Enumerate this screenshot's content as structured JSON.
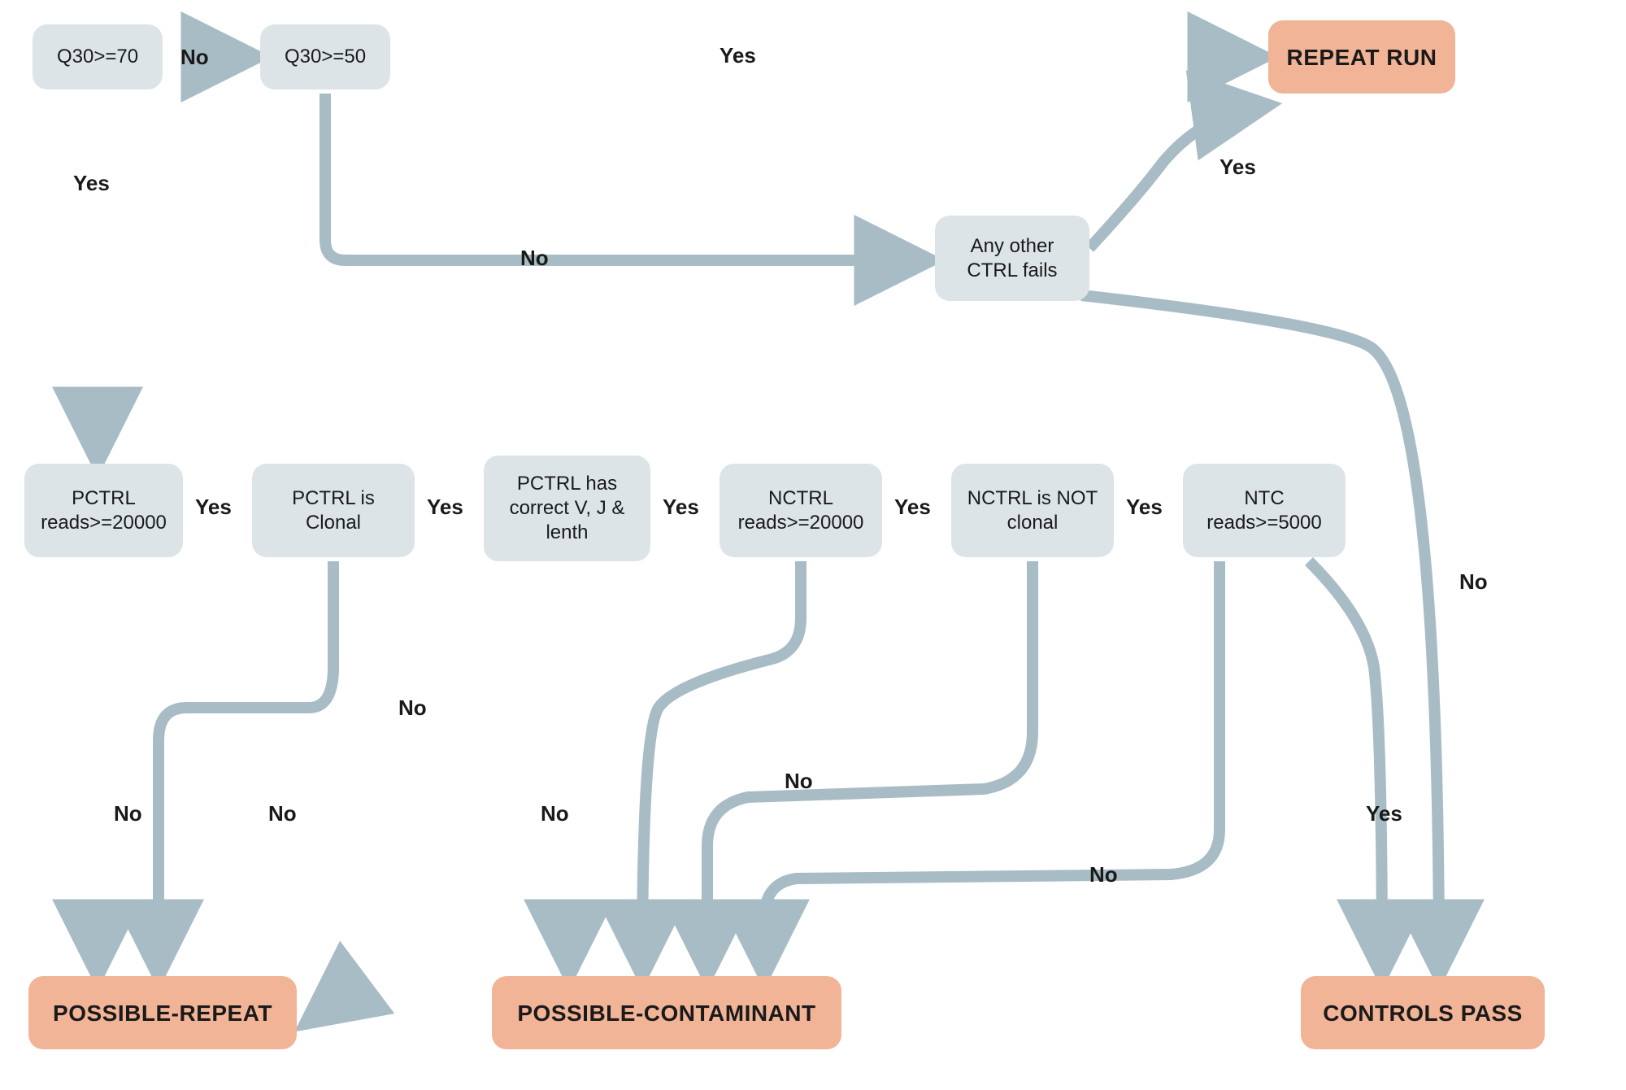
{
  "colors": {
    "decision_bg": "#dde4e8",
    "terminal_bg": "#f2b497",
    "arrow": "#a8bcc5",
    "text": "#1a1a1a"
  },
  "nodes": {
    "q30_70": {
      "label": "Q30>=70"
    },
    "q30_50": {
      "label": "Q30>=50"
    },
    "repeat_run": {
      "label": "REPEAT RUN"
    },
    "any_ctrl_fail": {
      "label": "Any other CTRL fails"
    },
    "pctrl_reads": {
      "label": "PCTRL reads>=20000"
    },
    "pctrl_clonal": {
      "label": "PCTRL is Clonal"
    },
    "pctrl_vj": {
      "label": "PCTRL has correct V, J & lenth"
    },
    "nctrl_reads": {
      "label": "NCTRL reads>=20000"
    },
    "nctrl_notclon": {
      "label": "NCTRL is NOT clonal"
    },
    "ntc_reads": {
      "label": "NTC reads>=5000"
    },
    "possible_repeat": {
      "label": "POSSIBLE-REPEAT"
    },
    "possible_contaminant": {
      "label": "POSSIBLE-CONTAMINANT"
    },
    "controls_pass": {
      "label": "CONTROLS PASS"
    }
  },
  "edges": {
    "q30_70_no": {
      "label": "No"
    },
    "q30_70_yes": {
      "label": "Yes"
    },
    "q30_50_yes": {
      "label": "Yes"
    },
    "q30_50_no": {
      "label": "No"
    },
    "anyctrl_yes": {
      "label": "Yes"
    },
    "anyctrl_no": {
      "label": "No"
    },
    "pctrl_reads_yes": {
      "label": "Yes"
    },
    "pctrl_reads_no": {
      "label": "No"
    },
    "pctrl_clonal_yes": {
      "label": "Yes"
    },
    "pctrl_clonal_no": {
      "label": "No"
    },
    "pctrl_vj_yes": {
      "label": "Yes"
    },
    "pctrl_vj_no": {
      "label": "No"
    },
    "nctrl_reads_yes": {
      "label": "Yes"
    },
    "nctrl_reads_no": {
      "label": "No"
    },
    "nctrl_notclon_yes": {
      "label": "Yes"
    },
    "nctrl_notclon_no": {
      "label": "No"
    },
    "ntc_reads_yes": {
      "label": "Yes"
    },
    "ntc_reads_no": {
      "label": "No"
    }
  }
}
